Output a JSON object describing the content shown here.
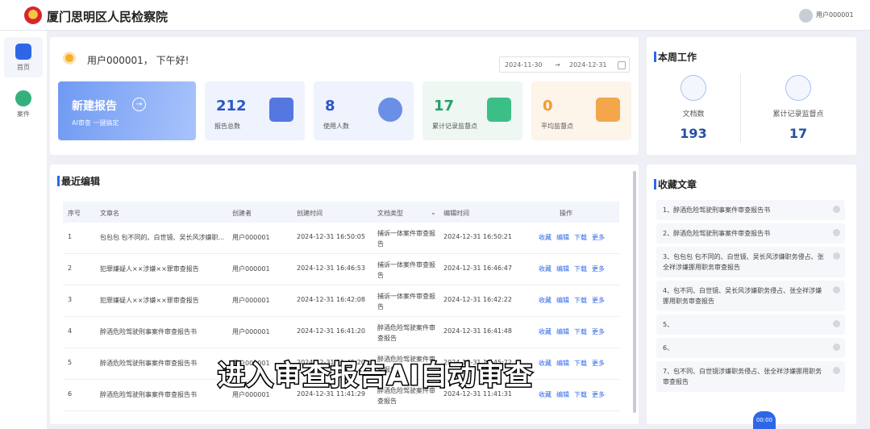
{
  "header": {
    "site_title": "厦门思明区人民检察院",
    "user_name": "用户000001"
  },
  "sidenav": [
    {
      "label": "首页"
    },
    {
      "label": "案件"
    }
  ],
  "dashboard": {
    "greeting": "用户000001， 下午好!",
    "date_start": "2024-11-30",
    "date_end": "2024-12-31",
    "new_report": {
      "title": "新建报告",
      "sub": "AI审查 一键搞定"
    },
    "stats": [
      {
        "value": "212",
        "label": "报告总数",
        "color": "#2d55c8",
        "bg": "#eef3fd"
      },
      {
        "value": "8",
        "label": "使用人数",
        "color": "#2d55c8",
        "bg": "#eef3fd"
      },
      {
        "value": "17",
        "label": "累计记录监督点",
        "color": "#21a46b",
        "bg": "#eef7f2"
      },
      {
        "value": "0",
        "label": "平均监督点",
        "color": "#f39a2c",
        "bg": "#fdf4ea"
      }
    ]
  },
  "week": {
    "title": "本周工作",
    "items": [
      {
        "label": "文档数",
        "value": "193"
      },
      {
        "label": "累计记录监督点",
        "value": "17"
      }
    ]
  },
  "recent": {
    "title": "最近编辑",
    "columns": [
      "序号",
      "文章名",
      "创建者",
      "创建时间",
      "文档类型",
      "编辑时间",
      "操作"
    ],
    "actions": [
      "收藏",
      "编辑",
      "下载",
      "更多"
    ],
    "rows": [
      {
        "no": "1",
        "name": "包包包 包不同的、白世镜、吴长风涉嫌职...",
        "creator": "用户000001",
        "created": "2024-12-31 16:50:05",
        "type": "捕诉一体案件审查报告",
        "edited": "2024-12-31 16:50:21"
      },
      {
        "no": "2",
        "name": "犯罪嫌疑人××涉嫌××罪审查报告",
        "creator": "用户000001",
        "created": "2024-12-31 16:46:53",
        "type": "捕诉一体案件审查报告",
        "edited": "2024-12-31 16:46:47"
      },
      {
        "no": "3",
        "name": "犯罪嫌疑人××涉嫌××罪审查报告",
        "creator": "用户000001",
        "created": "2024-12-31 16:42:08",
        "type": "捕诉一体案件审查报告",
        "edited": "2024-12-31 16:42:22"
      },
      {
        "no": "4",
        "name": "醉酒危险驾驶刑事案件审查报告书",
        "creator": "用户000001",
        "created": "2024-12-31 16:41:20",
        "type": "醉酒危险驾驶案件审查报告",
        "edited": "2024-12-31 16:41:48"
      },
      {
        "no": "5",
        "name": "醉酒危险驾驶刑事案件审查报告书",
        "creator": "用户000001",
        "created": "2024-12-31 11:45:20",
        "type": "醉酒危险驾驶案件审查报告",
        "edited": "2024-12-31 11:45:22"
      },
      {
        "no": "6",
        "name": "醉酒危险驾驶刑事案件审查报告书",
        "creator": "用户000001",
        "created": "2024-12-31 11:41:29",
        "type": "醉酒危险驾驶案件审查报告",
        "edited": "2024-12-31 11:41:31"
      }
    ]
  },
  "favorites": {
    "title": "收藏文章",
    "items": [
      "1、醉酒危险驾驶刑事案件审查报告书",
      "2、醉酒危险驾驶刑事案件审查报告书",
      "3、包包包 包不同的、白世镜、吴长风涉嫌职务侵占、张全祥涉嫌挪用职务审查报告",
      "4、包不同、白世镜、吴长风涉嫌职务侵占、张全祥涉嫌挪用职务审查报告",
      "5、",
      "6、",
      "7、包不同、白世镜涉嫌职务侵占、张全祥涉嫌挪用职务审查报告"
    ]
  },
  "overlay": {
    "subtitle": "进入审查报告AI自动审查",
    "bubble": "00:00"
  }
}
